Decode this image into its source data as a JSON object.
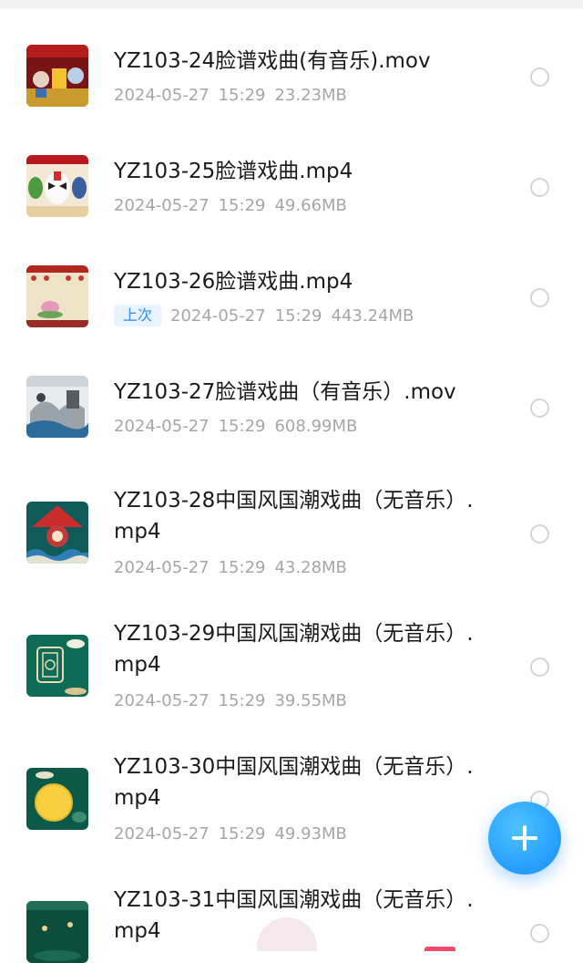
{
  "files": [
    {
      "name": "YZ103-24脸谱戏曲(有音乐).mov",
      "date": "2024-05-27",
      "time": "15:29",
      "size": "23.23MB",
      "badge": "",
      "thumb": "opera-stage-icon"
    },
    {
      "name": "YZ103-25脸谱戏曲.mp4",
      "date": "2024-05-27",
      "time": "15:29",
      "size": "49.66MB",
      "badge": "",
      "thumb": "opera-mask-icon"
    },
    {
      "name": "YZ103-26脸谱戏曲.mp4",
      "date": "2024-05-27",
      "time": "15:29",
      "size": "443.24MB",
      "badge": "上次",
      "thumb": "lotus-stage-icon"
    },
    {
      "name": "YZ103-27脸谱戏曲（有音乐）.mov",
      "date": "2024-05-27",
      "time": "15:29",
      "size": "608.99MB",
      "badge": "",
      "thumb": "ink-wash-icon"
    },
    {
      "name": "YZ103-28中国风国潮戏曲（无音乐）.mp4",
      "date": "2024-05-27",
      "time": "15:29",
      "size": "43.28MB",
      "badge": "",
      "thumb": "guochao-waves-icon"
    },
    {
      "name": "YZ103-29中国风国潮戏曲（无音乐）.mp4",
      "date": "2024-05-27",
      "time": "15:29",
      "size": "39.55MB",
      "badge": "",
      "thumb": "green-window-icon"
    },
    {
      "name": "YZ103-30中国风国潮戏曲（无音乐）.mp4",
      "date": "2024-05-27",
      "time": "15:29",
      "size": "49.93MB",
      "badge": "",
      "thumb": "moon-icon"
    },
    {
      "name": "YZ103-31中国风国潮戏曲（无音乐）.mp4",
      "date": "",
      "time": "",
      "size": "",
      "badge": "",
      "thumb": "dark-green-icon"
    }
  ],
  "fab": {
    "icon": "plus-icon",
    "color": "#2aa2ff"
  }
}
